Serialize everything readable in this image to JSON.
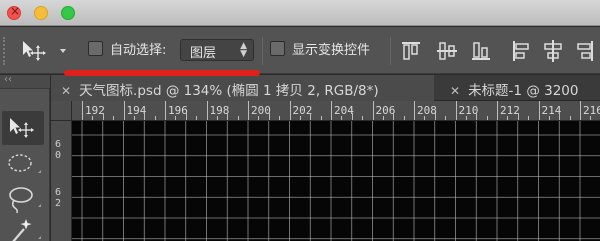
{
  "window": {
    "controls": [
      "close",
      "minimize",
      "maximize"
    ]
  },
  "options_bar": {
    "tool_icon": "move-tool-icon",
    "auto_select_label": "自动选择:",
    "auto_select_checked": false,
    "layer_select_value": "图层",
    "show_transform_label": "显示变换控件",
    "show_transform_checked": false,
    "align_icons": [
      "align-top-edges-icon",
      "align-vertical-centers-icon",
      "align-bottom-edges-icon",
      "align-left-edges-icon",
      "align-horizontal-centers-icon",
      "align-right-edges-icon"
    ],
    "highlight_color": "#e0201a"
  },
  "tabs": [
    {
      "title": "天气图标.psd @ 134% (椭圆 1 拷贝 2, RGB/8*)",
      "active": true
    },
    {
      "title": "未标题-1 @ 3200",
      "active": false
    }
  ],
  "toolbox": {
    "header": "‹‹",
    "tools": [
      "move-tool-icon",
      "elliptical-marquee-icon",
      "lasso-icon",
      "magic-wand-icon"
    ]
  },
  "ruler": {
    "top_labels": [
      "192",
      "194",
      "196",
      "198",
      "200",
      "202",
      "204",
      "206",
      "208",
      "210",
      "212",
      "214",
      "216"
    ],
    "left_labels": [
      "6\n0",
      "6\n2"
    ]
  },
  "canvas": {
    "background": "#060606",
    "grid_color": "#bdbdbd"
  }
}
